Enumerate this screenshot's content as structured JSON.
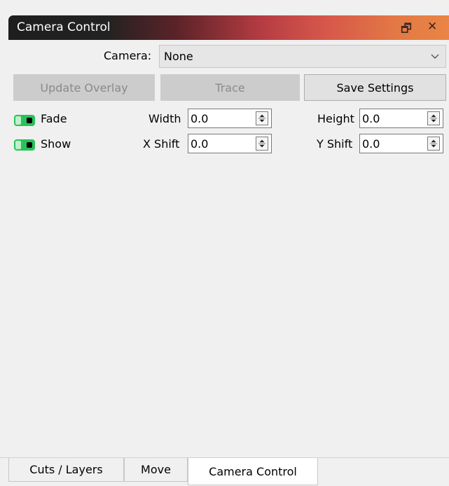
{
  "window": {
    "title": "Camera Control",
    "restore_icon": "restore-icon",
    "close_icon": "close-icon"
  },
  "camera": {
    "label": "Camera:",
    "value": "None"
  },
  "buttons": {
    "update_overlay": "Update Overlay",
    "trace": "Trace",
    "save_settings": "Save Settings"
  },
  "toggles": {
    "fade": "Fade",
    "show": "Show"
  },
  "fields": {
    "width": {
      "label": "Width",
      "value": "0.0"
    },
    "height": {
      "label": "Height",
      "value": "0.0"
    },
    "x_shift": {
      "label": "X Shift",
      "value": "0.0"
    },
    "y_shift": {
      "label": "Y Shift",
      "value": "0.0"
    }
  },
  "tabs": [
    "Cuts / Layers",
    "Move",
    "Camera Control"
  ],
  "colors": {
    "toggle_on": "#29c25a"
  }
}
